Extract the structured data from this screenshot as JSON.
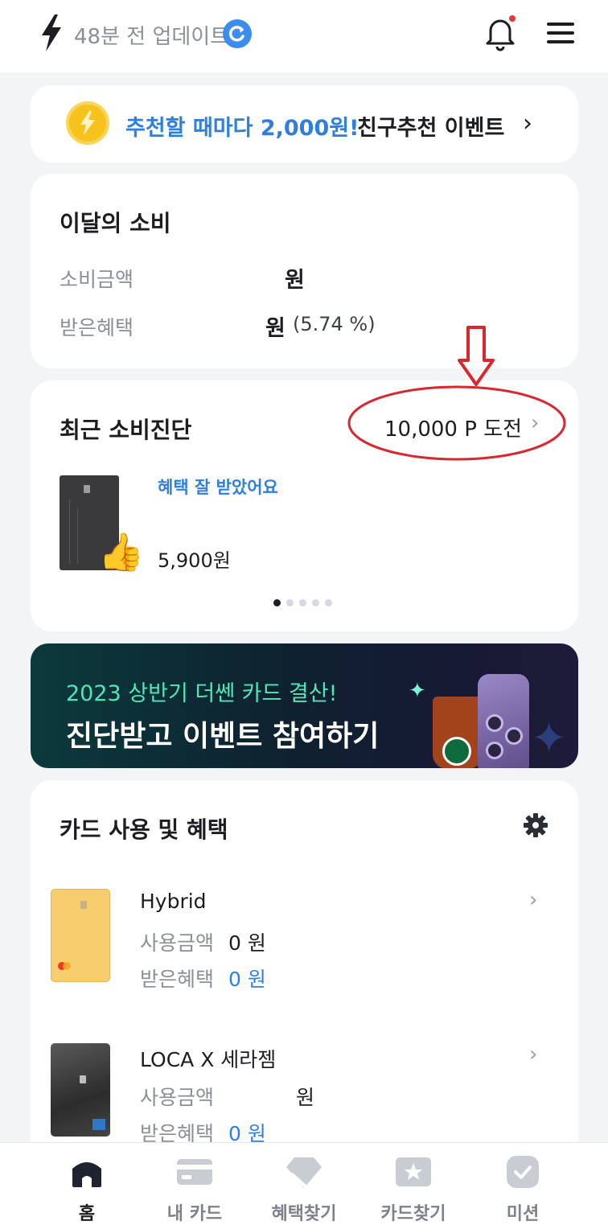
{
  "header": {
    "update_text": "48분 전 업데이트",
    "icons": [
      "bolt-icon",
      "refresh-icon",
      "bell-icon",
      "menu-icon"
    ],
    "notification_dot": true
  },
  "promo": {
    "highlight": "추천할 때마다 2,000원!",
    "text": "친구추천 이벤트",
    "chevron": "›"
  },
  "monthly": {
    "title": "이달의 소비",
    "spent_label": "소비금액",
    "spent_value": "원",
    "benefit_label": "받은혜택",
    "benefit_value": "원",
    "benefit_pct": "(5.74 %)"
  },
  "diagnosis": {
    "title": "최근 소비진단",
    "challenge": "10,000 P 도전",
    "chevron": "›",
    "message": "혜택 잘 받았어요",
    "amount": "5,900원",
    "pages": 5,
    "active_page": 0
  },
  "banner": {
    "line1": "2023 상반기 더쎈 카드 결산!",
    "line2": "진단받고 이벤트 참여하기"
  },
  "usage": {
    "title": "카드 사용 및 혜택",
    "cards": [
      {
        "name": "Hybrid",
        "spent_label": "사용금액",
        "spent": "0 원",
        "benefit_label": "받은혜택",
        "benefit": "0 원"
      },
      {
        "name": "LOCA X 세라젬",
        "spent_label": "사용금액",
        "spent": "원",
        "benefit_label": "받은혜택",
        "benefit": "0 원"
      }
    ]
  },
  "nav": {
    "items": [
      {
        "label": "홈",
        "icon": "home-icon",
        "active": true
      },
      {
        "label": "내 카드",
        "icon": "card-icon",
        "active": false
      },
      {
        "label": "혜택찾기",
        "icon": "diamond-icon",
        "active": false
      },
      {
        "label": "카드찾기",
        "icon": "star-card-icon",
        "active": false
      },
      {
        "label": "미션",
        "icon": "check-icon",
        "active": false
      }
    ]
  },
  "colors": {
    "accent": "#2f7fe0",
    "annotation": "#d9262f",
    "banner_text": "#4ee7b8"
  }
}
